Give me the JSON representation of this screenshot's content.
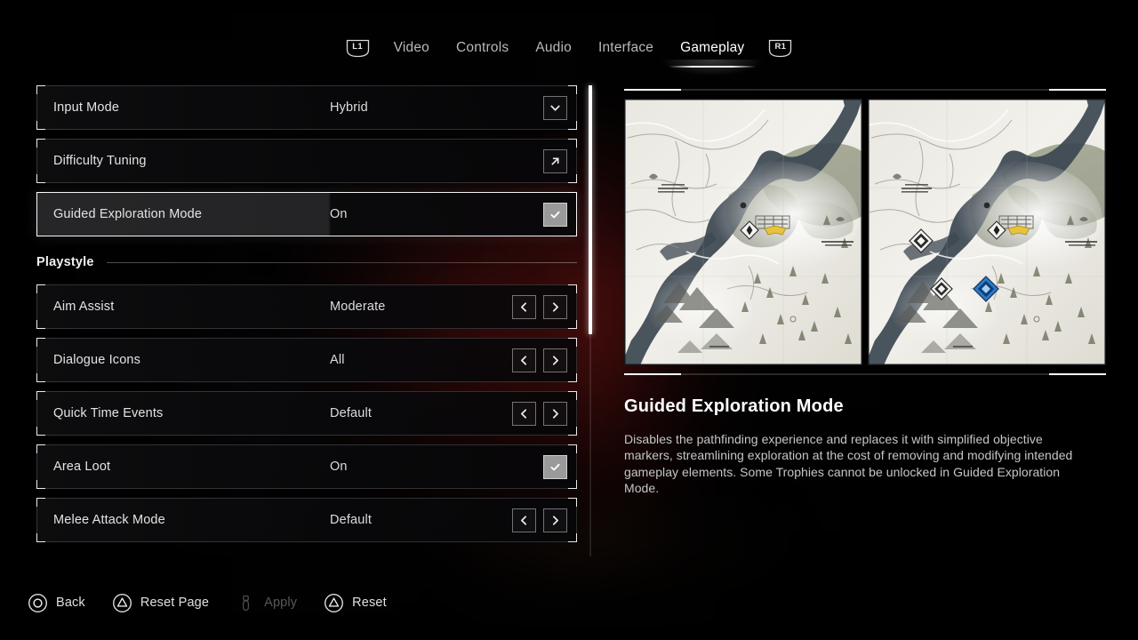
{
  "tabbar": {
    "left_bumper": "L1",
    "right_bumper": "R1",
    "tabs": [
      {
        "label": "Video",
        "active": false
      },
      {
        "label": "Controls",
        "active": false
      },
      {
        "label": "Audio",
        "active": false
      },
      {
        "label": "Interface",
        "active": false
      },
      {
        "label": "Gameplay",
        "active": true
      }
    ]
  },
  "settings": {
    "rows_top": [
      {
        "label": "Input Mode",
        "value": "Hybrid",
        "control": "chevron-down-icon",
        "selected": false
      },
      {
        "label": "Difficulty Tuning",
        "value": "",
        "control": "arrow-up-right-icon",
        "selected": false
      },
      {
        "label": "Guided Exploration Mode",
        "value": "On",
        "control": "checkbox-checked-icon",
        "selected": true
      }
    ],
    "section": {
      "title": "Playstyle"
    },
    "rows_playstyle": [
      {
        "label": "Aim Assist",
        "value": "Moderate",
        "control": "stepper-arrows",
        "selected": false
      },
      {
        "label": "Dialogue Icons",
        "value": "All",
        "control": "stepper-arrows",
        "selected": false
      },
      {
        "label": "Quick Time Events",
        "value": "Default",
        "control": "stepper-arrows",
        "selected": false
      },
      {
        "label": "Area Loot",
        "value": "On",
        "control": "checkbox-checked-icon",
        "selected": false
      },
      {
        "label": "Melee Attack Mode",
        "value": "Default",
        "control": "stepper-arrows",
        "selected": false
      }
    ],
    "stepper_prev_glyph": "‹",
    "stepper_next_glyph": "›"
  },
  "preview": {
    "title": "Guided Exploration Mode",
    "description": "Disables the pathfinding experience and replaces it with simplified objective markers, streamlining exploration at the cost of removing and modifying intended gameplay elements. Some Trophies cannot be unlocked in Guided Exploration Mode.",
    "image_left_name": "map-preview-off",
    "image_right_name": "map-preview-on"
  },
  "footer": {
    "buttons": [
      {
        "label": "Back",
        "glyph": "circle-button-icon",
        "disabled": false
      },
      {
        "label": "Reset Page",
        "glyph": "triangle-button-icon",
        "disabled": false
      },
      {
        "label": "Apply",
        "glyph": "key-button-icon",
        "disabled": true
      },
      {
        "label": "Reset",
        "glyph": "triangle-button-icon",
        "disabled": false
      }
    ]
  },
  "colors": {
    "accent_white": "#ffffff",
    "text_primary": "#e3e3e3",
    "text_dim": "#c6c6c6",
    "text_disabled": "#58585a",
    "marker_blue": "#2f79c9",
    "marker_gold": "#e8c33a"
  }
}
